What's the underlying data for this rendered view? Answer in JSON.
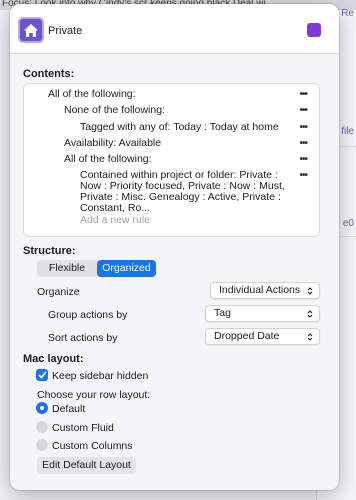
{
  "background": {
    "top_text_pre": "Focus: ",
    "top_text_link": "Look into why Cindy's scr",
    "top_text_mid": "  keeps going black",
    "top_text_post": " Deal wi",
    "right_fragments": [
      "Re",
      "file",
      "e0"
    ]
  },
  "header": {
    "icon": "house-icon",
    "name_value": "Private",
    "swatch_color": "#7d3ad8"
  },
  "contents": {
    "label": "Contents:",
    "rules": [
      "All of the following:",
      "None of the following:",
      "Tagged with any of: Today : Today at home",
      "Availability: Available",
      "All of the following:",
      "Contained within project or folder: Private : Now : Priority focused, Private : Now : Must, Private : Misc. Genealogy : Active, Private : Constant, Ro..."
    ],
    "more_label": "•••",
    "add_rule_placeholder": "Add a new rule"
  },
  "structure": {
    "label": "Structure:",
    "options": [
      "Flexible",
      "Organized"
    ],
    "selected": "Organized",
    "organize_label": "Organize",
    "organize_value": "Individual Actions",
    "group_label": "Group actions by",
    "group_value": "Tag",
    "sort_label": "Sort actions by",
    "sort_value": "Dropped Date"
  },
  "mac_layout": {
    "label": "Mac layout:",
    "keep_sidebar_hidden_label": "Keep sidebar hidden",
    "keep_sidebar_hidden": true,
    "row_layout_label": "Choose your row layout:",
    "row_layouts": [
      "Default",
      "Custom Fluid",
      "Custom Columns"
    ],
    "selected_row_layout": "Default",
    "edit_button_label": "Edit Default Layout"
  },
  "colors": {
    "accent": "#1c75e8",
    "icon_bg": "#6b55c8"
  }
}
